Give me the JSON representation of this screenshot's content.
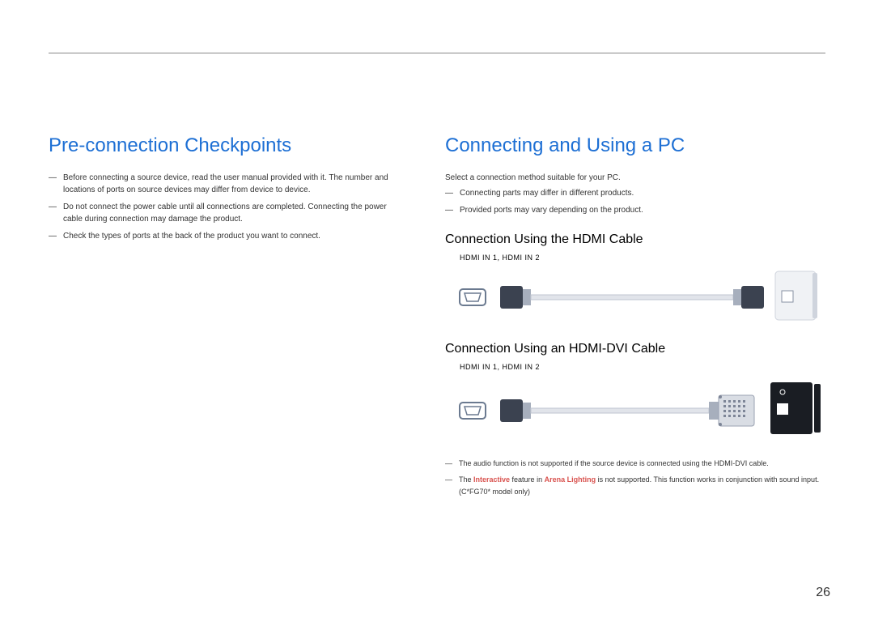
{
  "left": {
    "heading": "Pre-connection Checkpoints",
    "notes": [
      "Before connecting a source device, read the user manual provided with it. The number and locations of ports on source devices may differ from device to device.",
      "Do not connect the power cable until all connections are completed. Connecting the power cable during connection may damage the product.",
      "Check the types of ports at the back of the product you want to connect."
    ]
  },
  "right": {
    "heading": "Connecting and Using a PC",
    "intro": [
      "Select a connection method suitable for your PC.",
      "Connecting parts may differ in different products.",
      "Provided ports may vary depending on the product."
    ],
    "sub1": "Connection Using the HDMI Cable",
    "port1": "HDMI IN 1, HDMI IN 2",
    "sub2": "Connection Using an HDMI-DVI Cable",
    "port2": "HDMI IN 1, HDMI IN 2",
    "footnotes": {
      "line1": "The audio function is not supported if the source device is connected using the HDMI-DVI cable.",
      "line2_prefix": "The ",
      "line2_interactive": "Interactive",
      "line2_mid": " feature in ",
      "line2_arena": "Arena Lighting",
      "line2_suffix": " is not supported. This function works in conjunction with sound input. (C*FG70* model only)"
    }
  },
  "page_number": "26"
}
